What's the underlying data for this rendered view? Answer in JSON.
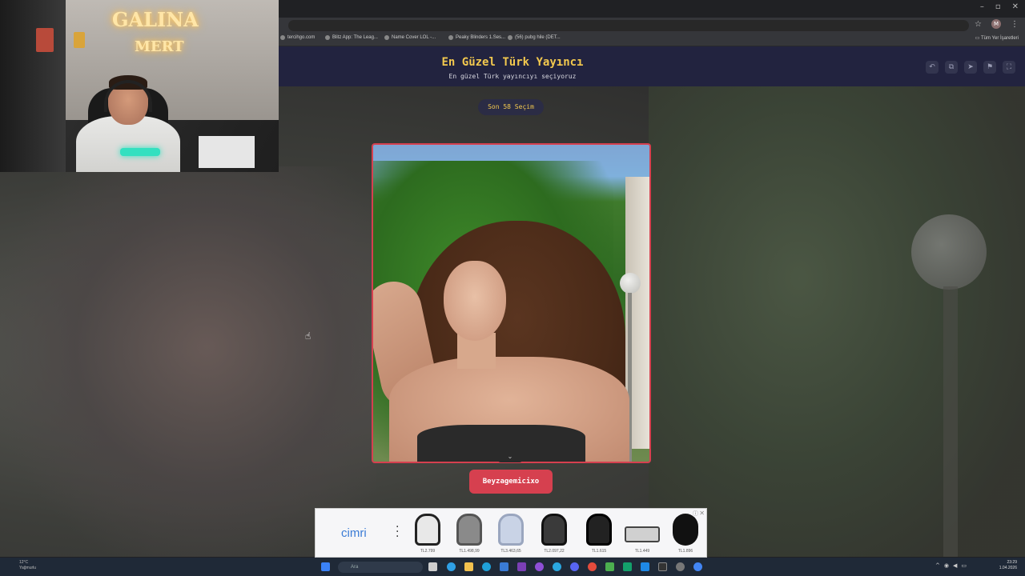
{
  "browser": {
    "bookmarks": [
      {
        "label": "tercihgo.com"
      },
      {
        "label": "Blitz App: The Leag..."
      },
      {
        "label": "Name Cover LOL -..."
      },
      {
        "label": "Peaky Blinders 1.Ses..."
      },
      {
        "label": "(56) pubg hile (DET..."
      }
    ],
    "all_bookmarks_label": "Tüm Yer İşaretleri",
    "profile_initial": "M"
  },
  "page": {
    "title": "En Güzel Türk Yayıncı",
    "subtitle": "En güzel Türk yayıncıyı seçiyoruz",
    "round_label": "Son 58 Seçim",
    "candidate_name": "Beyzagemicixo",
    "header_icons": [
      "undo-icon",
      "copy-icon",
      "send-icon",
      "flag-icon",
      "fullscreen-icon"
    ]
  },
  "ad": {
    "brand": "cimri",
    "products": [
      {
        "price": "TL2.799"
      },
      {
        "price": "TL1.498,99"
      },
      {
        "price": "TL3.463,65"
      },
      {
        "price": "TL2.097,22"
      },
      {
        "price": "TL1.615"
      },
      {
        "price": "TL1.449"
      },
      {
        "price": "TL1.896"
      }
    ]
  },
  "taskbar": {
    "weather_temp": "12°C",
    "weather_desc": "Yağmurlu",
    "search_placeholder": "Ara",
    "time": "23:29",
    "date": "1.04.2026"
  },
  "webcam": {
    "neon_line1": "GALINA",
    "neon_line2": "MERT"
  },
  "colors": {
    "accent_red": "#d6404f",
    "title_yellow": "#f3c94e",
    "header_bg": "#22233f"
  }
}
